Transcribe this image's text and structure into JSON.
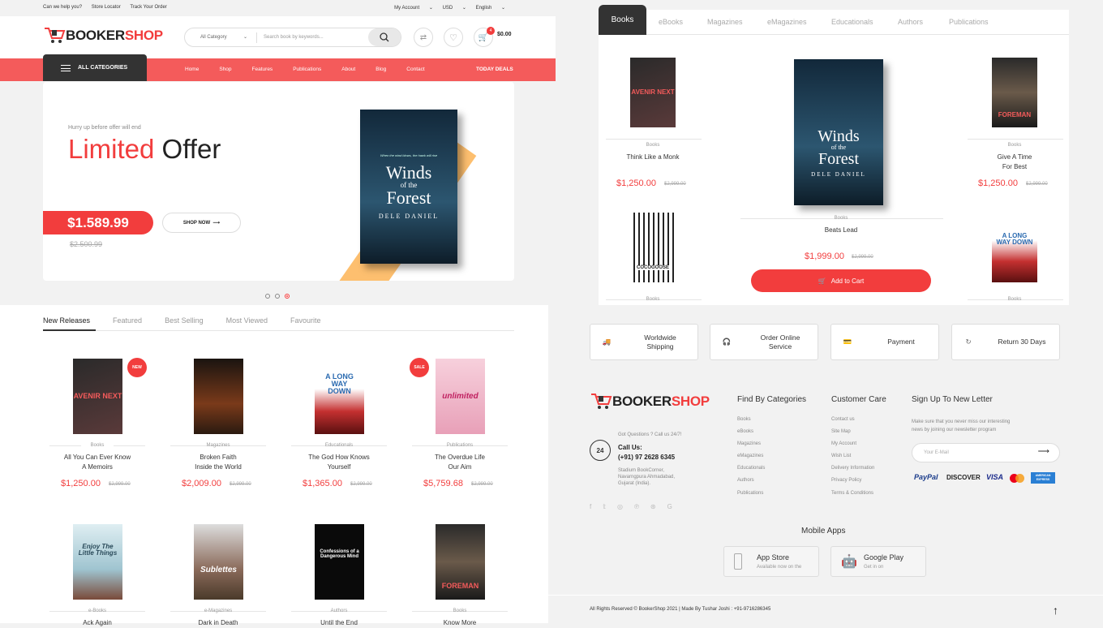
{
  "topbar": {
    "help": "Can we help you?",
    "store": "Store Locator",
    "track": "Track Your Order",
    "account": "My Account",
    "currency": "USD",
    "language": "English"
  },
  "brand": {
    "b": "BOOKER",
    "s": "SHOP"
  },
  "search": {
    "category": "All Category",
    "placeholder": "Search book by keywords..."
  },
  "cart": {
    "count": "4",
    "total": "$0.00"
  },
  "allcat": "ALL CATEGORIES",
  "nav": [
    "Home",
    "Shop",
    "Features",
    "Publications",
    "About",
    "Blog",
    "Contact"
  ],
  "today": "TODAY DEALS",
  "hero": {
    "small": "Hurry up before offer will end",
    "big1": "Limited",
    "big2": " Offer",
    "price": "$1.589.99",
    "old": "$2.500.99",
    "shop": "SHOP NOW",
    "book_tag": "When the wind blows, the hawk will rise",
    "book_t1": "Winds",
    "book_t2": "of the",
    "book_t3": "Forest",
    "book_author": "DELE DANIEL"
  },
  "tabs2": [
    "New Releases",
    "Featured",
    "Best Selling",
    "Most Viewed",
    "Favourite"
  ],
  "products": [
    {
      "cat": "Books",
      "t1": "All You Can Ever Know",
      "t2": "A Memoirs",
      "price": "$1,250.00",
      "old": "$2,999.00",
      "tag": "NEW",
      "cover": "AVENIR NEXT"
    },
    {
      "cat": "Magazines",
      "t1": "Broken Faith",
      "t2": "Inside the World",
      "price": "$2,009.00",
      "old": "$2,999.00",
      "cover": ""
    },
    {
      "cat": "Educationals",
      "t1": "The God How Knows",
      "t2": "Yourself",
      "price": "$1,365.00",
      "old": "$2,999.00",
      "cover": "A LONG WAY DOWN"
    },
    {
      "cat": "Publications",
      "t1": "The Overdue Life",
      "t2": "Our Aim",
      "price": "$5,759.68",
      "old": "$2,999.00",
      "tag": "SALE",
      "cover": "unlimited"
    },
    {
      "cat": "e-Books",
      "t1": "Ack Again",
      "cover": "Enjoy The Little Things"
    },
    {
      "cat": "e-Magazines",
      "t1": "Dark in Death",
      "cover": "Sublettes"
    },
    {
      "cat": "Authors",
      "t1": "Until the End",
      "cover": "Confessions of a Dangerous Mind"
    },
    {
      "cat": "Books",
      "t1": "Know More",
      "cover": "FOREMAN"
    }
  ],
  "rtabs": [
    "Books",
    "eBooks",
    "Magazines",
    "eMagazines",
    "Educationals",
    "Authors",
    "Publications"
  ],
  "featured": {
    "left": {
      "cat": "Books",
      "title": "Think Like a Monk",
      "price": "$1,250.00",
      "old": "$2,999.00",
      "cover": "AVENIR NEXT"
    },
    "center": {
      "cat": "Books",
      "title": "Beats Lead",
      "price": "$1,999.00",
      "old": "$2,999.00"
    },
    "right": {
      "cat": "Books",
      "t1": "Give A Time",
      "t2": "For Best",
      "price": "$1,250.00",
      "old": "$2,999.00",
      "cover": "FOREMAN"
    },
    "left2": {
      "cat": "Books",
      "cover": "COCOGOOSE"
    },
    "right2": {
      "cat": "Books",
      "cover": "A LONG WAY DOWN"
    },
    "addcart": "Add to Cart"
  },
  "features": [
    {
      "t1": "Worldwide",
      "t2": "Shipping"
    },
    {
      "t1": "Order Online",
      "t2": "Service"
    },
    {
      "t1": "Payment",
      "t2": ""
    },
    {
      "t1": "Return 30 Days",
      "t2": ""
    }
  ],
  "footer": {
    "questions": "Got Questions ? Call us 24/7!",
    "call": "Call Us:",
    "phone": "(+91) 97 2628 6345",
    "addr1": "Stadium BookCorner,",
    "addr2": "Navarngpura Ahmadabad,",
    "addr3": "Gujarat (India).",
    "h1": "Find By Categories",
    "cats": [
      "Books",
      "eBooks",
      "Magazines",
      "eMagazines",
      "Educationals",
      "Authors",
      "Publications"
    ],
    "h2": "Customer Care",
    "care": [
      "Contact us",
      "Site Map",
      "My Account",
      "Wish List",
      "Delivery Information",
      "Privacy Policy",
      "Terms & Conditions"
    ],
    "h3": "Sign Up To New Letter",
    "news1": "Make sure that you never miss our interesting",
    "news2": "news by joining our newsletter program",
    "email_ph": "Your E-Mail",
    "pays": [
      "PayPal",
      "DISCOVER",
      "VISA",
      "AMERICAN EXPRESS"
    ],
    "apps": "Mobile Apps",
    "app1": "App Store",
    "app1s": "Available now on the",
    "app2": "Google Play",
    "app2s": "Get in on",
    "copy": "All Rights Reserved © BookerShop 2021 | Made By Tushar Joshi : +91-9716286345"
  },
  "colors": {
    "accent": "#f23d3d",
    "dark": "#333333"
  }
}
